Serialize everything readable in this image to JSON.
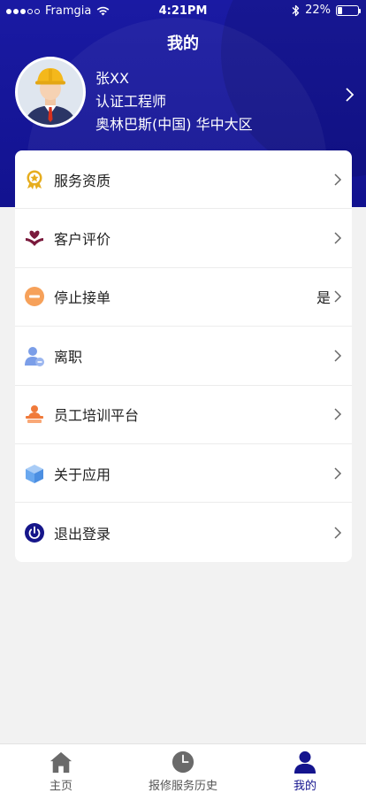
{
  "status_bar": {
    "carrier": "Framgia",
    "time": "4:21PM",
    "battery": "22%",
    "battery_level": 0.22
  },
  "header": {
    "title": "我的"
  },
  "profile": {
    "name": "张XX",
    "role": "认证工程师",
    "company": "奥林巴斯(中国) 华中大区"
  },
  "menu": {
    "items": [
      {
        "label": "服务资质",
        "icon": "award-badge-icon",
        "color": "#e6ad1e"
      },
      {
        "label": "客户评价",
        "icon": "heart-hand-icon",
        "color": "#7a1a3c"
      },
      {
        "label": "停止接单",
        "icon": "stop-order-icon",
        "color": "#f6a15a",
        "value": "是"
      },
      {
        "label": "离职",
        "icon": "user-leave-icon",
        "color": "#7b9ee8"
      },
      {
        "label": "员工培训平台",
        "icon": "training-icon",
        "color": "#f07a3a"
      },
      {
        "label": "关于应用",
        "icon": "box-cube-icon",
        "color": "#6aa8ef"
      },
      {
        "label": "退出登录",
        "icon": "power-icon",
        "color": "#16168a"
      }
    ]
  },
  "tabbar": {
    "tabs": [
      {
        "label": "主页",
        "icon": "home-icon"
      },
      {
        "label": "报修服务历史",
        "icon": "clock-icon"
      },
      {
        "label": "我的",
        "icon": "person-icon",
        "active": true
      }
    ]
  },
  "colors": {
    "header": "#1a1aa3",
    "active_tab": "#14148e",
    "background": "#f2f2f2"
  }
}
